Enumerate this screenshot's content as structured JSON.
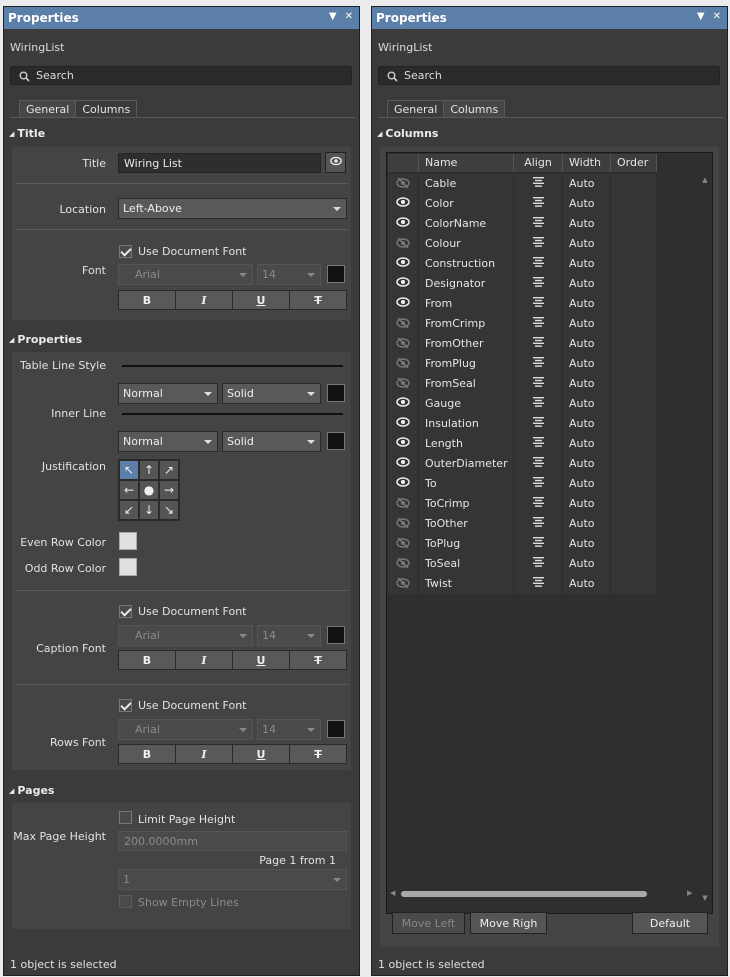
{
  "left": {
    "title": "Properties",
    "object_name": "WiringList",
    "search_placeholder": "Search",
    "tabs": [
      "General",
      "Columns"
    ],
    "sections": {
      "title": "Title",
      "properties": "Properties",
      "pages": "Pages"
    },
    "title_section": {
      "title_label": "Title",
      "title_value": "Wiring List",
      "location_label": "Location",
      "location_value": "Left-Above",
      "font_label": "Font",
      "use_doc_font": "Use Document Font",
      "font_family": "Arial",
      "font_size": "14"
    },
    "properties_section": {
      "table_line_style": "Table Line Style",
      "table_line_weight": "Normal",
      "table_line_type": "Solid",
      "inner_line": "Inner Line",
      "inner_line_weight": "Normal",
      "inner_line_type": "Solid",
      "justification": "Justification",
      "even_row_color": "Even Row Color",
      "odd_row_color": "Odd Row Color",
      "caption_font": "Caption Font",
      "caption_use_doc_font": "Use Document Font",
      "caption_font_family": "Arial",
      "caption_font_size": "14",
      "rows_font": "Rows Font",
      "rows_use_doc_font": "Use Document Font",
      "rows_font_family": "Arial",
      "rows_font_size": "14"
    },
    "pages_section": {
      "max_page_height": "Max Page Height",
      "limit_page_height": "Limit Page Height",
      "height_value": "200.0000mm",
      "page_info": "Page 1 from 1",
      "page_select": "1",
      "show_empty_lines": "Show Empty Lines"
    },
    "status": "1 object is selected"
  },
  "right": {
    "title": "Properties",
    "object_name": "WiringList",
    "search_placeholder": "Search",
    "tabs": [
      "General",
      "Columns"
    ],
    "section": "Columns",
    "headers": [
      "Name",
      "Align",
      "Width",
      "Order"
    ],
    "rows": [
      {
        "name": "Cable",
        "width": "Auto",
        "visible": false
      },
      {
        "name": "Color",
        "width": "Auto",
        "visible": true
      },
      {
        "name": "ColorName",
        "width": "Auto",
        "visible": true
      },
      {
        "name": "Colour",
        "width": "Auto",
        "visible": false
      },
      {
        "name": "Construction",
        "width": "Auto",
        "visible": true
      },
      {
        "name": "Designator",
        "width": "Auto",
        "visible": true
      },
      {
        "name": "From",
        "width": "Auto",
        "visible": true
      },
      {
        "name": "FromCrimp",
        "width": "Auto",
        "visible": false
      },
      {
        "name": "FromOther",
        "width": "Auto",
        "visible": false
      },
      {
        "name": "FromPlug",
        "width": "Auto",
        "visible": false
      },
      {
        "name": "FromSeal",
        "width": "Auto",
        "visible": false
      },
      {
        "name": "Gauge",
        "width": "Auto",
        "visible": true
      },
      {
        "name": "Insulation",
        "width": "Auto",
        "visible": true
      },
      {
        "name": "Length",
        "width": "Auto",
        "visible": true
      },
      {
        "name": "OuterDiameter",
        "width": "Auto",
        "visible": true
      },
      {
        "name": "To",
        "width": "Auto",
        "visible": true
      },
      {
        "name": "ToCrimp",
        "width": "Auto",
        "visible": false
      },
      {
        "name": "ToOther",
        "width": "Auto",
        "visible": false
      },
      {
        "name": "ToPlug",
        "width": "Auto",
        "visible": false
      },
      {
        "name": "ToSeal",
        "width": "Auto",
        "visible": false
      },
      {
        "name": "Twist",
        "width": "Auto",
        "visible": false
      }
    ],
    "buttons": {
      "move_left": "Move Left",
      "move_right": "Move Righ",
      "default": "Default"
    },
    "status": "1 object is selected"
  },
  "colors": {
    "titlebar": "#5c7fa9",
    "panel": "#3b3b3b"
  }
}
